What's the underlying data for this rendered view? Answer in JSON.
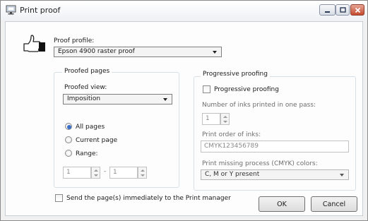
{
  "window": {
    "title": "Print proof"
  },
  "proof_profile": {
    "label": "Proof profile:",
    "value": "Epson 4900 raster proof"
  },
  "proofed_pages": {
    "group_title": "Proofed pages",
    "view_label": "Proofed view:",
    "view_value": "Imposition",
    "radios": [
      {
        "label": "All pages",
        "checked": true
      },
      {
        "label": "Current page",
        "checked": false
      },
      {
        "label": "Range:",
        "checked": false
      }
    ],
    "range_from": "1",
    "range_sep": "-",
    "range_to": "1"
  },
  "progressive": {
    "group_title": "Progressive proofing",
    "checkbox_label": "Progressive proofing",
    "checked": false,
    "inks_label": "Number of inks printed in one pass:",
    "inks_value": "1",
    "order_label": "Print order of inks:",
    "order_value": "CMYK123456789",
    "missing_label": "Print missing process (CMYK) colors:",
    "missing_value": "C, M or Y present"
  },
  "send_checkbox": {
    "label": "Send the page(s) immediately to the Print manager",
    "checked": false
  },
  "buttons": {
    "ok": "OK",
    "cancel": "Cancel"
  }
}
